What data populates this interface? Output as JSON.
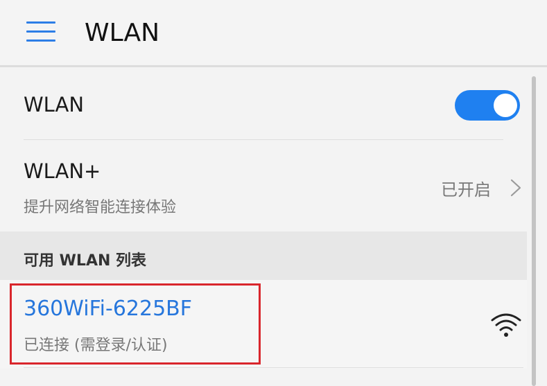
{
  "app_bar": {
    "menu_icon": "menu-icon",
    "title": "WLAN"
  },
  "wlan_toggle": {
    "label": "WLAN",
    "enabled": true,
    "accent_color": "#1f80f0"
  },
  "wlan_plus": {
    "title": "WLAN+",
    "subtitle": "提升网络智能连接体验",
    "status": "已开启",
    "chevron_icon": "chevron-right-icon"
  },
  "available_section": {
    "header": "可用 WLAN 列表"
  },
  "networks": [
    {
      "ssid": "360WiFi-6225BF",
      "status": "已连接 (需登录/认证)",
      "signal_icon": "wifi-signal-icon",
      "highlighted": true,
      "highlight_color": "#d9262c",
      "ssid_color": "#2676dc"
    }
  ]
}
